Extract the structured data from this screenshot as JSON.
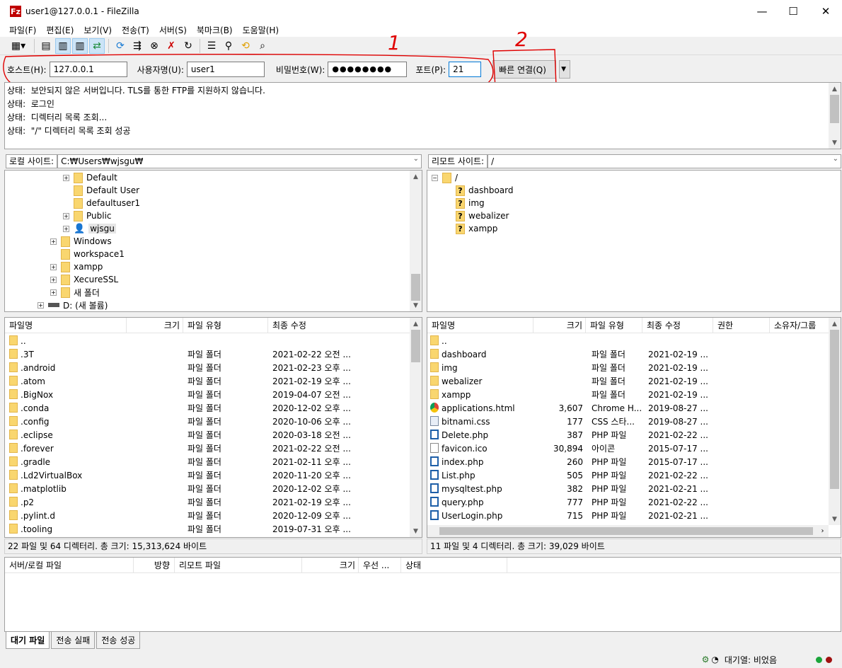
{
  "window": {
    "title": "user1@127.0.0.1 - FileZilla",
    "app_icon": "Fz"
  },
  "menu": [
    "파일(F)",
    "편집(E)",
    "보기(V)",
    "전송(T)",
    "서버(S)",
    "북마크(B)",
    "도움말(H)"
  ],
  "quickconnect": {
    "host_label": "호스트(H):",
    "host_value": "127.0.0.1",
    "user_label": "사용자명(U):",
    "user_value": "user1",
    "pass_label": "비밀번호(W):",
    "pass_value": "●●●●●●●●",
    "port_label": "포트(P):",
    "port_value": "21",
    "connect_label": "빠른 연결(Q)",
    "annotation_1": "1",
    "annotation_2": "2",
    "annotation_color": "#e00000"
  },
  "log": [
    {
      "prefix": "상태:",
      "text": "보안되지 않은 서버입니다. TLS를 통한 FTP를 지원하지 않습니다."
    },
    {
      "prefix": "상태:",
      "text": "로그인"
    },
    {
      "prefix": "상태:",
      "text": "디렉터리 목록 조회..."
    },
    {
      "prefix": "상태:",
      "text": "\"/\" 디렉터리 목록 조회 성공"
    }
  ],
  "local": {
    "site_label": "로컬 사이트:",
    "path": "C:₩Users₩wjsgu₩",
    "tree": [
      {
        "label": "Default",
        "expandable": true,
        "icon": "folder"
      },
      {
        "label": "Default User",
        "expandable": false,
        "icon": "folder"
      },
      {
        "label": "defaultuser1",
        "expandable": false,
        "icon": "folder"
      },
      {
        "label": "Public",
        "expandable": true,
        "icon": "folder"
      },
      {
        "label": "wjsgu",
        "expandable": true,
        "icon": "user"
      },
      {
        "label": "Windows",
        "expandable": true,
        "icon": "folder"
      },
      {
        "label": "workspace1",
        "expandable": false,
        "icon": "folder"
      },
      {
        "label": "xampp",
        "expandable": true,
        "icon": "folder"
      },
      {
        "label": "XecureSSL",
        "expandable": true,
        "icon": "folder"
      },
      {
        "label": "새 폴더",
        "expandable": true,
        "icon": "folder"
      },
      {
        "label": "D: (새 볼륨)",
        "expandable": true,
        "icon": "drive"
      }
    ],
    "columns": [
      "파일명",
      "크기",
      "파일 유형",
      "최종 수정"
    ],
    "files": [
      {
        "name": "..",
        "size": "",
        "type": "",
        "modified": ""
      },
      {
        "name": ".3T",
        "size": "",
        "type": "파일 폴더",
        "modified": "2021-02-22 오전 ..."
      },
      {
        "name": ".android",
        "size": "",
        "type": "파일 폴더",
        "modified": "2021-02-23 오후 ..."
      },
      {
        "name": ".atom",
        "size": "",
        "type": "파일 폴더",
        "modified": "2021-02-19 오후 ..."
      },
      {
        "name": ".BigNox",
        "size": "",
        "type": "파일 폴더",
        "modified": "2019-04-07 오전 ..."
      },
      {
        "name": ".conda",
        "size": "",
        "type": "파일 폴더",
        "modified": "2020-12-02 오후 ..."
      },
      {
        "name": ".config",
        "size": "",
        "type": "파일 폴더",
        "modified": "2020-10-06 오후 ..."
      },
      {
        "name": ".eclipse",
        "size": "",
        "type": "파일 폴더",
        "modified": "2020-03-18 오전 ..."
      },
      {
        "name": ".forever",
        "size": "",
        "type": "파일 폴더",
        "modified": "2021-02-22 오전 ..."
      },
      {
        "name": ".gradle",
        "size": "",
        "type": "파일 폴더",
        "modified": "2021-02-11 오후 ..."
      },
      {
        "name": ".Ld2VirtualBox",
        "size": "",
        "type": "파일 폴더",
        "modified": "2020-11-20 오후 ..."
      },
      {
        "name": ".matplotlib",
        "size": "",
        "type": "파일 폴더",
        "modified": "2020-12-02 오후 ..."
      },
      {
        "name": ".p2",
        "size": "",
        "type": "파일 폴더",
        "modified": "2021-02-19 오후 ..."
      },
      {
        "name": ".pylint.d",
        "size": "",
        "type": "파일 폴더",
        "modified": "2020-12-09 오후 ..."
      },
      {
        "name": ".tooling",
        "size": "",
        "type": "파일 폴더",
        "modified": "2019-07-31 오후 ..."
      }
    ],
    "status": "22 파일 및 64 디렉터리. 총 크기: 15,313,624 바이트"
  },
  "remote": {
    "site_label": "리모트 사이트:",
    "path": "/",
    "tree_root": "/",
    "tree": [
      "dashboard",
      "img",
      "webalizer",
      "xampp"
    ],
    "columns": [
      "파일명",
      "크기",
      "파일 유형",
      "최종 수정",
      "권한",
      "소유자/그룹"
    ],
    "files": [
      {
        "name": "..",
        "size": "",
        "type": "",
        "modified": "",
        "icon": "folder"
      },
      {
        "name": "dashboard",
        "size": "",
        "type": "파일 폴더",
        "modified": "2021-02-19 ...",
        "icon": "folder"
      },
      {
        "name": "img",
        "size": "",
        "type": "파일 폴더",
        "modified": "2021-02-19 ...",
        "icon": "folder"
      },
      {
        "name": "webalizer",
        "size": "",
        "type": "파일 폴더",
        "modified": "2021-02-19 ...",
        "icon": "folder"
      },
      {
        "name": "xampp",
        "size": "",
        "type": "파일 폴더",
        "modified": "2021-02-19 ...",
        "icon": "folder"
      },
      {
        "name": "applications.html",
        "size": "3,607",
        "type": "Chrome H...",
        "modified": "2019-08-27 ...",
        "icon": "chrome"
      },
      {
        "name": "bitnami.css",
        "size": "177",
        "type": "CSS 스타...",
        "modified": "2019-08-27 ...",
        "icon": "css"
      },
      {
        "name": "Delete.php",
        "size": "387",
        "type": "PHP 파일",
        "modified": "2021-02-22 ...",
        "icon": "php"
      },
      {
        "name": "favicon.ico",
        "size": "30,894",
        "type": "아이콘",
        "modified": "2015-07-17 ...",
        "icon": "file"
      },
      {
        "name": "index.php",
        "size": "260",
        "type": "PHP 파일",
        "modified": "2015-07-17 ...",
        "icon": "php"
      },
      {
        "name": "List.php",
        "size": "505",
        "type": "PHP 파일",
        "modified": "2021-02-22 ...",
        "icon": "php"
      },
      {
        "name": "mysqltest.php",
        "size": "382",
        "type": "PHP 파일",
        "modified": "2021-02-21 ...",
        "icon": "php"
      },
      {
        "name": "query.php",
        "size": "777",
        "type": "PHP 파일",
        "modified": "2021-02-22 ...",
        "icon": "php"
      },
      {
        "name": "UserLogin.php",
        "size": "715",
        "type": "PHP 파일",
        "modified": "2021-02-21 ...",
        "icon": "php"
      }
    ],
    "status": "11 파일 및 4 디렉터리. 총 크기: 39,029 바이트"
  },
  "queue": {
    "columns": [
      "서버/로컬 파일",
      "방향",
      "리모트 파일",
      "크기",
      "우선 ...",
      "상태"
    ],
    "tabs": [
      "대기 파일",
      "전송 실패",
      "전송 성공"
    ],
    "status": "대기열: 비었음"
  }
}
